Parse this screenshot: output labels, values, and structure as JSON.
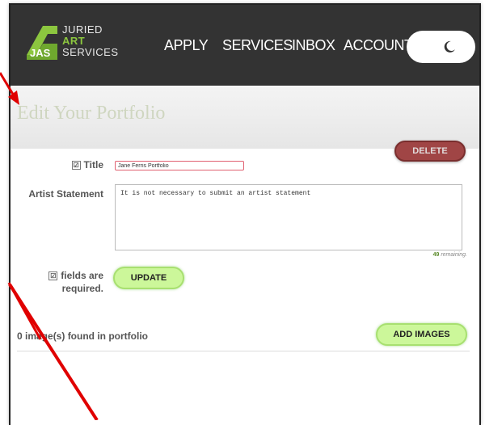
{
  "header": {
    "logo": {
      "line1": "JURIED",
      "line2": "ART",
      "line3": "SERVICES",
      "mark": "JAS"
    },
    "nav": [
      {
        "label": "APPLY"
      },
      {
        "label": "SERVICES"
      },
      {
        "label": "INBOX"
      },
      {
        "label": "ACCOUNT"
      }
    ],
    "theme_toggle_icon": "moon-icon"
  },
  "page": {
    "title": "Edit Your Portfolio"
  },
  "form": {
    "delete_label": "DELETE",
    "title_label": "Title",
    "title_value": "Jane Ferris Portfolio",
    "statement_label": "Artist Statement",
    "statement_value": "It is not necessary to submit an artist statement",
    "remaining_count": "49",
    "remaining_text": "remaining.",
    "required_line1": "fields are",
    "required_line2": "required.",
    "update_label": "UPDATE"
  },
  "images": {
    "found_text": "0 image(s) found in portfolio",
    "add_label": "ADD IMAGES"
  },
  "colors": {
    "header_bg": "#333333",
    "accent_green": "#8cc63f",
    "button_green": "#ccf79a",
    "delete_red": "#a04545",
    "annotation_arrow": "#e00000"
  }
}
